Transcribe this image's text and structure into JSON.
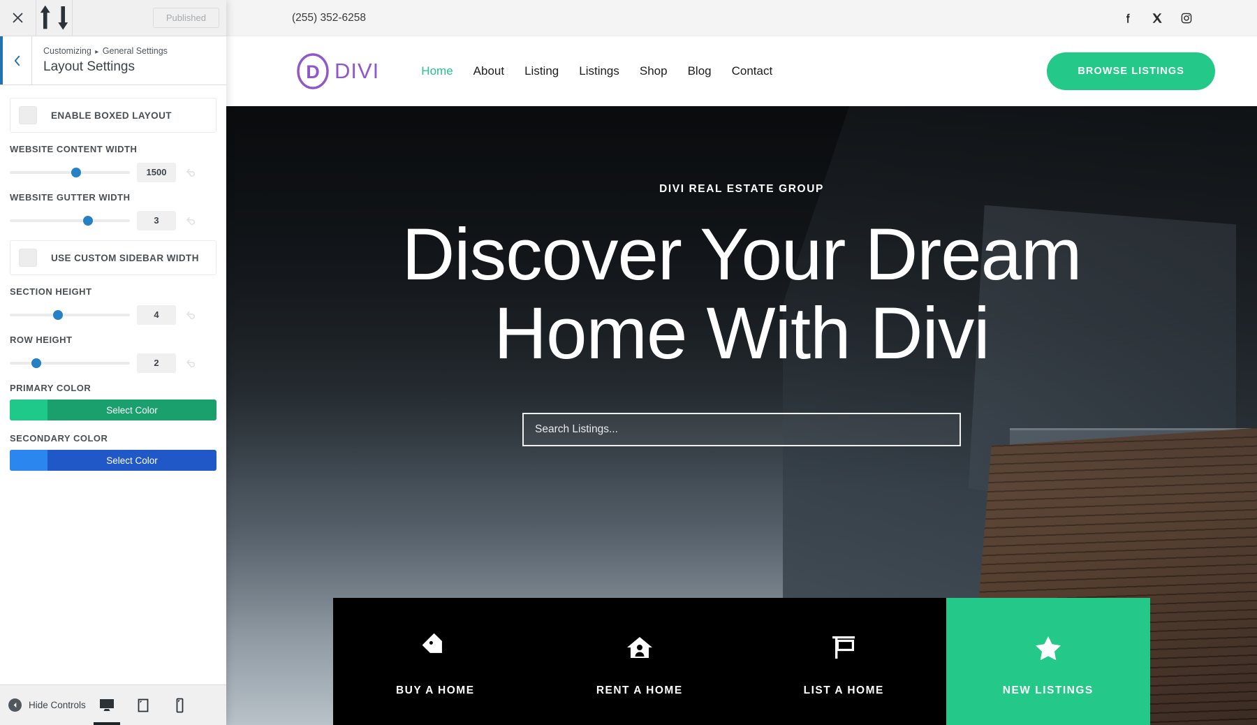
{
  "customizer": {
    "topbar": {
      "close_icon": "close-icon",
      "collapse_icon": "expand-collapse-icon",
      "published_label": "Published"
    },
    "header": {
      "back_icon": "chevron-left-icon",
      "breadcrumb_root": "Customizing",
      "breadcrumb_sep": "▸",
      "breadcrumb_section": "General Settings",
      "title": "Layout Settings"
    },
    "controls": [
      {
        "type": "checkbox",
        "name": "enable-boxed-layout",
        "label": "ENABLE BOXED LAYOUT",
        "checked": false
      },
      {
        "type": "slider",
        "name": "website-content-width",
        "label": "WEBSITE CONTENT WIDTH",
        "value": "1500",
        "percent": 55
      },
      {
        "type": "slider",
        "name": "website-gutter-width",
        "label": "WEBSITE GUTTER WIDTH",
        "value": "3",
        "percent": 65
      },
      {
        "type": "checkbox",
        "name": "use-custom-sidebar-width",
        "label": "USE CUSTOM SIDEBAR WIDTH",
        "checked": false
      },
      {
        "type": "slider",
        "name": "section-height",
        "label": "SECTION HEIGHT",
        "value": "4",
        "percent": 40
      },
      {
        "type": "slider",
        "name": "row-height",
        "label": "ROW HEIGHT",
        "value": "2",
        "percent": 22
      },
      {
        "type": "color",
        "name": "primary-color",
        "label": "PRIMARY COLOR",
        "button_label": "Select Color",
        "swatch": "#1ec98a",
        "fill": "#19a06c"
      },
      {
        "type": "color",
        "name": "secondary-color",
        "label": "SECONDARY COLOR",
        "button_label": "Select Color",
        "swatch": "#2b86f0",
        "fill": "#2158c8"
      }
    ],
    "reset_icon": "undo-reset-icon",
    "footer": {
      "hide_controls_label": "Hide Controls",
      "hide_controls_icon": "collapse-left-icon",
      "devices": [
        {
          "name": "desktop",
          "icon": "desktop-icon",
          "active": true
        },
        {
          "name": "tablet",
          "icon": "tablet-icon",
          "active": false
        },
        {
          "name": "mobile",
          "icon": "mobile-icon",
          "active": false
        }
      ]
    }
  },
  "site": {
    "topbar": {
      "phone": "(255) 352-6258",
      "social": [
        {
          "name": "facebook",
          "icon": "facebook-icon"
        },
        {
          "name": "x-twitter",
          "icon": "x-icon"
        },
        {
          "name": "instagram",
          "icon": "instagram-icon"
        }
      ]
    },
    "nav": {
      "logo_mark_icon": "divi-logo-icon",
      "logo_text": "DIVI",
      "logo_color": "#8f57c9",
      "menu": [
        {
          "label": "Home",
          "active": true
        },
        {
          "label": "About",
          "active": false
        },
        {
          "label": "Listing",
          "active": false
        },
        {
          "label": "Listings",
          "active": false
        },
        {
          "label": "Shop",
          "active": false
        },
        {
          "label": "Blog",
          "active": false
        },
        {
          "label": "Contact",
          "active": false
        }
      ],
      "cta_label": "BROWSE LISTINGS",
      "accent_color": "#24c98a"
    },
    "hero": {
      "kicker": "DIVI REAL ESTATE GROUP",
      "title_line1": "Discover Your Dream",
      "title_line2": "Home With Divi",
      "search_placeholder": "Search Listings...",
      "search_value": ""
    },
    "cta_cards": [
      {
        "name": "buy-a-home",
        "label": "BUY A HOME",
        "icon": "tag-icon",
        "accent": false
      },
      {
        "name": "rent-a-home",
        "label": "RENT A HOME",
        "icon": "home-person-icon",
        "accent": false
      },
      {
        "name": "list-a-home",
        "label": "LIST A HOME",
        "icon": "for-sale-sign-icon",
        "accent": false
      },
      {
        "name": "new-listings",
        "label": "NEW LISTINGS",
        "icon": "star-icon",
        "accent": true
      }
    ]
  }
}
